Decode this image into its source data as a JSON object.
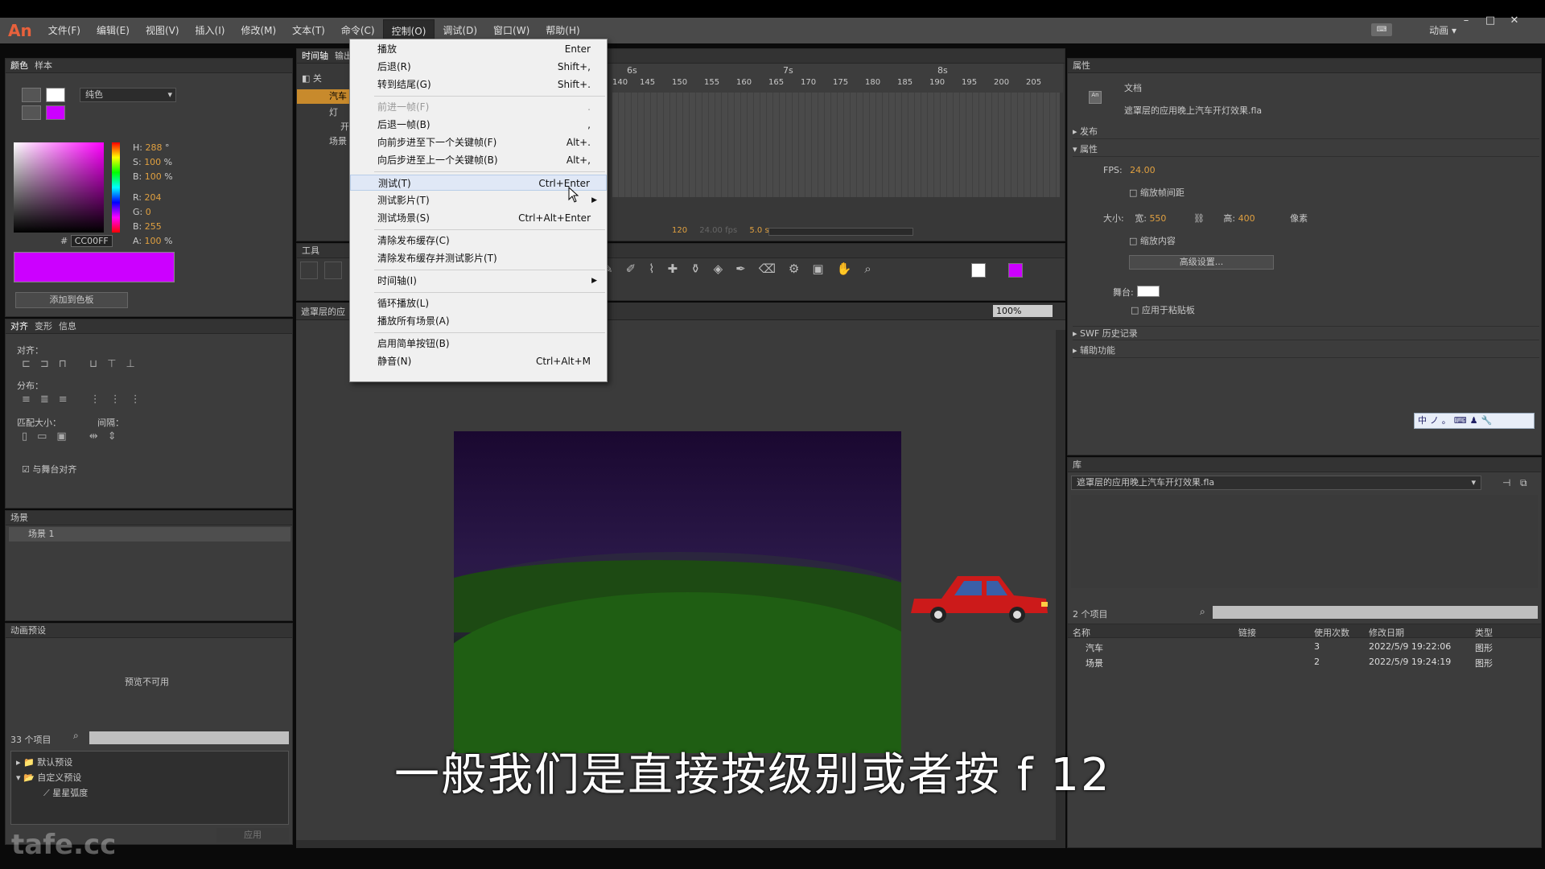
{
  "app": {
    "logo": "An",
    "workspace": "动画 ▾"
  },
  "menubar": {
    "items": [
      "文件(F)",
      "编辑(E)",
      "视图(V)",
      "插入(I)",
      "修改(M)",
      "文本(T)",
      "命令(C)",
      "控制(O)",
      "调试(D)",
      "窗口(W)",
      "帮助(H)"
    ],
    "active": "控制(O)"
  },
  "control_menu": {
    "items": [
      {
        "label": "播放",
        "shortcut": "Enter"
      },
      {
        "label": "后退(R)",
        "shortcut": "Shift+,"
      },
      {
        "label": "转到结尾(G)",
        "shortcut": "Shift+."
      },
      {
        "label": "前进一帧(F)",
        "shortcut": ".",
        "disabled": true
      },
      {
        "label": "后退一帧(B)",
        "shortcut": ","
      },
      {
        "label": "向前步进至下一个关键帧(F)",
        "shortcut": "Alt+."
      },
      {
        "label": "向后步进至上一个关键帧(B)",
        "shortcut": "Alt+,"
      },
      {
        "label": "测试(T)",
        "shortcut": "Ctrl+Enter",
        "highlighted": true
      },
      {
        "label": "测试影片(T)",
        "shortcut": "",
        "submenu": true
      },
      {
        "label": "测试场景(S)",
        "shortcut": "Ctrl+Alt+Enter"
      },
      {
        "label": "清除发布缓存(C)",
        "shortcut": ""
      },
      {
        "label": "清除发布缓存并测试影片(T)",
        "shortcut": ""
      },
      {
        "label": "时间轴(I)",
        "shortcut": "",
        "submenu": true
      },
      {
        "label": "循环播放(L)",
        "shortcut": ""
      },
      {
        "label": "播放所有场景(A)",
        "shortcut": ""
      },
      {
        "label": "启用简单按钮(B)",
        "shortcut": ""
      },
      {
        "label": "静音(N)",
        "shortcut": "Ctrl+Alt+M"
      }
    ]
  },
  "color_panel": {
    "tabs": [
      "颜色",
      "样本"
    ],
    "fill_type": "纯色",
    "h": "288",
    "s": "100",
    "b": "100",
    "r": "204",
    "g": "0",
    "b2": "255",
    "hex": "CC00FF",
    "alpha": "100",
    "add_swatch": "添加到色板",
    "color": "#cc00ff"
  },
  "align_panel": {
    "tabs": [
      "对齐",
      "变形",
      "信息"
    ],
    "align_label": "对齐：",
    "distribute_label": "分布：",
    "match_size_label": "匹配大小：",
    "spacing_label": "间隔：",
    "stage_align": "与舞台对齐"
  },
  "scene_panel": {
    "title": "场景",
    "scene": "场景 1"
  },
  "presets_panel": {
    "title": "动画预设",
    "preview": "预览不可用",
    "count": "33 个项目",
    "folders": [
      "默认预设",
      "自定义预设"
    ],
    "item": "星星弧度",
    "apply": "应用"
  },
  "timeline": {
    "tabs": [
      "时间轴",
      "输出"
    ],
    "layers": [
      "汽车",
      "灯",
      "开",
      "场景"
    ],
    "layer_header": "关",
    "seconds": [
      "6s",
      "7s",
      "8s"
    ],
    "frames": [
      "140",
      "145",
      "150",
      "155",
      "160",
      "165",
      "170",
      "175",
      "180",
      "185",
      "190",
      "195",
      "200",
      "205"
    ],
    "current_frame": "120",
    "fps": "24.00 fps",
    "time": "5.0 s"
  },
  "tools": {
    "title": "工具"
  },
  "stage": {
    "crumb": "遮罩层的应",
    "zoom": "100%"
  },
  "properties": {
    "title": "属性",
    "doc_label": "文档",
    "doc_name": "遮罩层的应用晚上汽车开灯效果.fla",
    "publish": "发布",
    "props": "属性",
    "fps_label": "FPS:",
    "fps": "24.00",
    "scale_spans": "缩放帧间距",
    "size_label": "大小:",
    "width_label": "宽:",
    "width": "550",
    "height_label": "高:",
    "height": "400",
    "unit": "像素",
    "scale_content": "缩放内容",
    "advanced": "高级设置...",
    "stage_label": "舞台:",
    "apply_paste": "应用于粘贴板",
    "swf_history": "SWF 历史记录",
    "accessibility": "辅助功能"
  },
  "ime": {
    "labels": [
      "中",
      "ノ",
      "。",
      "⌨",
      "♟",
      "🔧"
    ]
  },
  "library": {
    "title": "库",
    "file": "遮罩层的应用晚上汽车开灯效果.fla",
    "count": "2 个项目",
    "columns": [
      "名称",
      "链接",
      "使用次数",
      "修改日期",
      "类型"
    ],
    "rows": [
      {
        "name": "汽车",
        "link": "",
        "uses": "3",
        "date": "2022/5/9 19:22:06",
        "type": "图形"
      },
      {
        "name": "场景",
        "link": "",
        "uses": "2",
        "date": "2022/5/9 19:24:19",
        "type": "图形"
      }
    ]
  },
  "subtitle": "一般我们是直接按级别或者按 f 12",
  "watermark": "tafe.cc"
}
